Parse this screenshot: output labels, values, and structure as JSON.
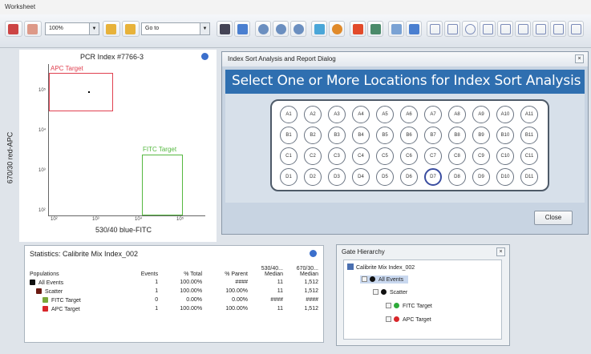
{
  "window": {
    "title": "Worksheet"
  },
  "toolbar": {
    "zoom_value": "100%",
    "goto_label": "Go to"
  },
  "plot": {
    "title": "PCR Index #7766-3",
    "ylabel": "670/30 red-APC",
    "xlabel": "530/40 blue-FITC",
    "gate_apc": "APC Target",
    "gate_fitc": "FITC Target",
    "tick_x": [
      "10²",
      "10³",
      "10⁴",
      "10⁵"
    ],
    "tick_y": [
      "10²",
      "10³",
      "10⁴",
      "10⁵"
    ]
  },
  "dialog": {
    "title": "Index Sort Analysis and Report Dialog",
    "heading": "Select One or More Locations for Index Sort Analysis",
    "close_label": "Close",
    "selected_well": "D7",
    "rows": [
      [
        "A1",
        "A2",
        "A3",
        "A4",
        "A5",
        "A6",
        "A7",
        "A8",
        "A9",
        "A10",
        "A11"
      ],
      [
        "B1",
        "B2",
        "B3",
        "B4",
        "B5",
        "B6",
        "B7",
        "B8",
        "B9",
        "B10",
        "B11"
      ],
      [
        "C1",
        "C2",
        "C3",
        "C4",
        "C5",
        "C6",
        "C7",
        "C8",
        "C9",
        "C10",
        "C11"
      ],
      [
        "D1",
        "D2",
        "D3",
        "D4",
        "D5",
        "D6",
        "D7",
        "D8",
        "D9",
        "D10",
        "D11"
      ]
    ]
  },
  "stats": {
    "title": "Statistics: Calibrite Mix Index_002",
    "headers": [
      "Populations",
      "Events",
      "% Total",
      "% Parent",
      "530/40... Median",
      "670/30... Median"
    ],
    "rows": [
      {
        "name": "All Events",
        "color": "#111111",
        "events": "1",
        "total": "100.00%",
        "parent": "####",
        "m1": "11",
        "m2": "1,512",
        "indent": 0
      },
      {
        "name": "Scatter",
        "color": "#6b1a12",
        "events": "1",
        "total": "100.00%",
        "parent": "100.00%",
        "m1": "11",
        "m2": "1,512",
        "indent": 1
      },
      {
        "name": "FITC Target",
        "color": "#7aa83a",
        "events": "0",
        "total": "0.00%",
        "parent": "0.00%",
        "m1": "####",
        "m2": "####",
        "indent": 2
      },
      {
        "name": "APC Target",
        "color": "#d8262a",
        "events": "1",
        "total": "100.00%",
        "parent": "100.00%",
        "m1": "11",
        "m2": "1,512",
        "indent": 2
      }
    ]
  },
  "gate_hierarchy": {
    "title": "Gate Hierarchy",
    "root": "Calibrite Mix Index_002",
    "nodes": [
      {
        "label": "All Events",
        "color": "#111111"
      },
      {
        "label": "Scatter",
        "color": "#111111"
      },
      {
        "label": "FITC Target",
        "color": "#2eaa3a"
      },
      {
        "label": "APC Target",
        "color": "#d8262a"
      }
    ]
  }
}
